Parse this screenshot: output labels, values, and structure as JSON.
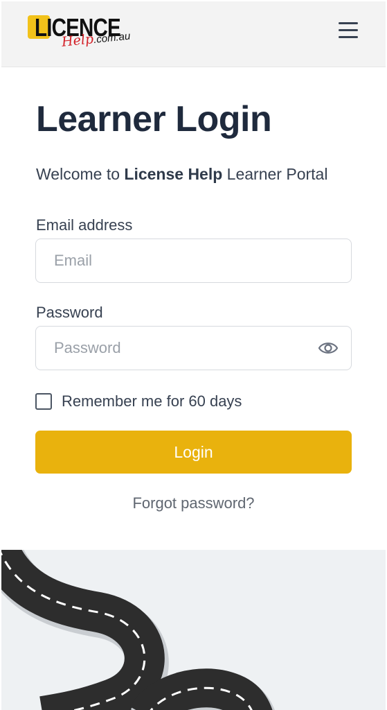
{
  "header": {
    "logo": {
      "word": "LICENCE",
      "sub_script": "Help",
      "sub_domain": ".com.au"
    },
    "menu_icon": "hamburger-menu-icon"
  },
  "main": {
    "title": "Learner Login",
    "welcome_prefix": "Welcome to ",
    "welcome_brand": "License Help",
    "welcome_suffix": " Learner Portal",
    "email": {
      "label": "Email address",
      "placeholder": "Email",
      "value": ""
    },
    "password": {
      "label": "Password",
      "placeholder": "Password",
      "value": "",
      "toggle_icon": "eye-icon"
    },
    "remember": {
      "label": "Remember me for 60 days",
      "checked": false
    },
    "login_label": "Login",
    "forgot_label": "Forgot password?"
  },
  "colors": {
    "accent": "#e9b20d",
    "logo_yellow": "#f2c21a",
    "logo_red": "#d32027",
    "title": "#1f2a3d",
    "road": "#2d2d2d",
    "road_bg": "#eef1f3"
  },
  "decoration": {
    "illustration": "winding-road-illustration"
  }
}
